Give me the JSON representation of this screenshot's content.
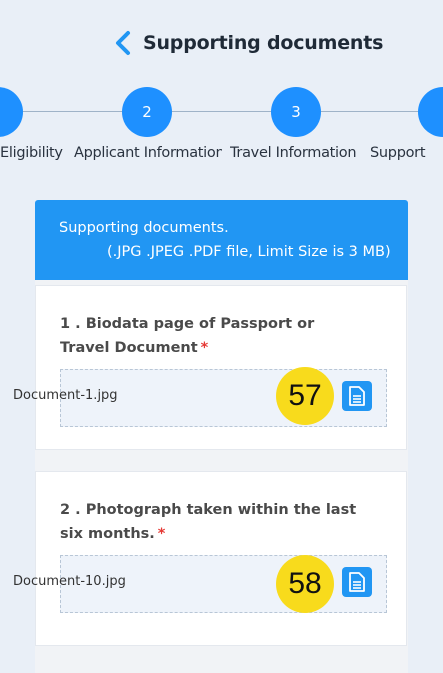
{
  "header": {
    "title": "Supporting documents"
  },
  "stepper": {
    "steps": [
      {
        "number": "",
        "label": "Eligibility"
      },
      {
        "number": "2",
        "label": "Applicant Information"
      },
      {
        "number": "3",
        "label": "Travel Information"
      },
      {
        "number": "",
        "label": "Supporting documents"
      }
    ]
  },
  "card": {
    "title": "Supporting documents.",
    "subtitle": "(.JPG .JPEG .PDF file, Limit Size is 3 MB)"
  },
  "documents": [
    {
      "label": "1 . Biodata page of Passport or Travel Document",
      "required": "*",
      "file_name": "Document-1.jpg",
      "marker": "57"
    },
    {
      "label": "2 . Photograph taken within the last six months.",
      "required": "*",
      "file_name": "Document-10.jpg",
      "marker": "58"
    }
  ],
  "colors": {
    "accent": "#2196f3",
    "step": "#1e90ff",
    "required": "#e53935",
    "marker": "#f8db1c"
  },
  "icons": {
    "back": "chevron-left-icon",
    "file": "document-icon"
  }
}
